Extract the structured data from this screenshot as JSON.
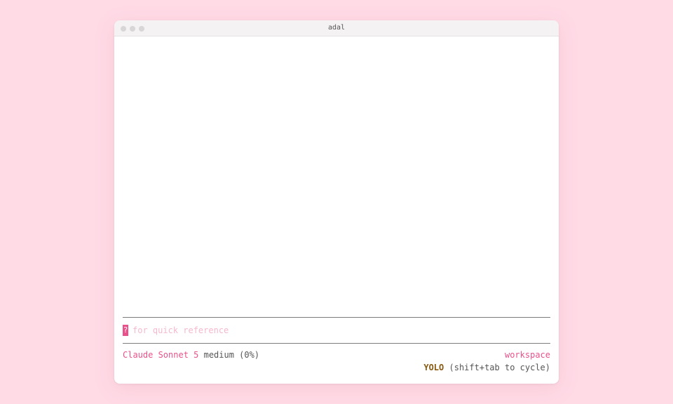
{
  "window": {
    "title": "adal"
  },
  "prompt": {
    "cursor_char": "?",
    "placeholder": "for quick reference"
  },
  "status": {
    "model": "Claude Sonnet 5",
    "effort": "medium (0%)",
    "workspace": "workspace",
    "mode": "YOLO",
    "mode_hint": "(shift+tab to cycle)"
  },
  "colors": {
    "background": "#ffdbe6",
    "accent": "#e8518a",
    "mode": "#8a5a12"
  }
}
